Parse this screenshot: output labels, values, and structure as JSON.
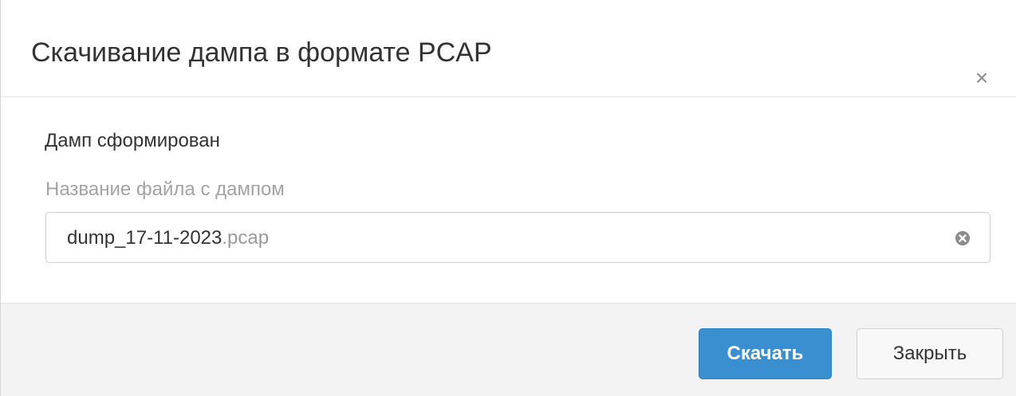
{
  "dialog": {
    "title": "Скачивание дампа в формате PCAP",
    "close_symbol": "×"
  },
  "body": {
    "status_text": "Дамп сформирован",
    "field_label": "Название файла с дампом",
    "filename_value": "dump_17-11-2023",
    "filename_extension": ".pcap"
  },
  "footer": {
    "download_label": "Скачать",
    "close_label": "Закрыть"
  },
  "icons": {
    "close": "close-icon",
    "clear": "clear-input-icon"
  },
  "colors": {
    "primary": "#3a8fd0",
    "footer_bg": "#f3f3f3",
    "text": "#333333",
    "muted": "#a3a3a3"
  }
}
